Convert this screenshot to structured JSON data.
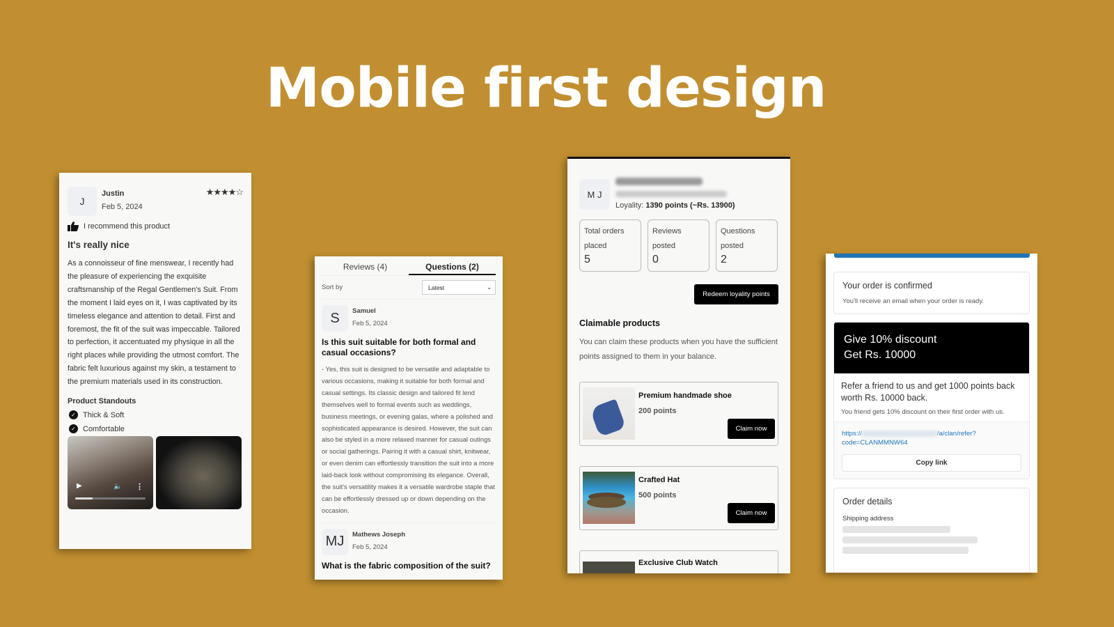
{
  "hero": {
    "title": "Mobile first design"
  },
  "review_panel": {
    "avatar_initial": "J",
    "name": "Justin",
    "date": "Feb 5, 2024",
    "rating": 4,
    "rating_max": 5,
    "stars_text": "★★★★☆",
    "recommend_text": "I recommend this product",
    "title": "It's really nice",
    "body": "As a connoisseur of fine menswear, I recently had the pleasure of experiencing the exquisite craftsmanship of the Regal Gentlemen's Suit. From the moment I laid eyes on it, I was captivated by its timeless elegance and attention to detail. First and foremost, the fit of the suit was impeccable. Tailored to perfection, it accentuated my physique in all the right places while providing the utmost comfort. The fabric felt luxurious against my skin, a testament to the premium materials used in its construction.",
    "standouts_title": "Product Standouts",
    "standouts": [
      "Thick & Soft",
      "Comfortable"
    ],
    "video_progress": 0.25
  },
  "questions_panel": {
    "tabs": [
      {
        "label": "Reviews (4)",
        "active": false
      },
      {
        "label": "Questions (2)",
        "active": true
      }
    ],
    "sort_label": "Sort by",
    "sort_value": "Latest",
    "questions": [
      {
        "avatar": "S",
        "name": "Samuel",
        "date": "Feb 5, 2024",
        "question": "Is this suit suitable for both formal and casual occasions?",
        "answer": "- Yes, this suit is designed to be versatile and adaptable to various occasions, making it suitable for both formal and casual settings. Its classic design and tailored fit lend themselves well to formal events such as weddings, business meetings, or evening galas, where a polished and sophisticated appearance is desired. However, the suit can also be styled in a more relaxed manner for casual outings or social gatherings. Pairing it with a casual shirt, knitwear, or even denim can effortlessly transition the suit into a more laid-back look without compromising its elegance. Overall, the suit's versatility makes it a versatile wardrobe staple that can be effortlessly dressed up or down depending on the occasion."
      },
      {
        "avatar": "MJ",
        "name": "Mathews Joseph",
        "date": "Feb 5, 2024",
        "question": "What is the fabric composition of the suit?",
        "answer": ""
      }
    ]
  },
  "loyalty_panel": {
    "avatar": "M J",
    "loyalty_label": "Loyality:",
    "loyalty_value": "1390 points (~Rs. 13900)",
    "stats": [
      {
        "label": "Total orders placed",
        "value": "5"
      },
      {
        "label": "Reviews posted",
        "value": "0"
      },
      {
        "label": "Questions posted",
        "value": "2"
      }
    ],
    "redeem_label": "Redeem loyality points",
    "claimable_title": "Claimable products",
    "claimable_desc": "You can claim these products when you have the sufficient points assigned to them in your balance.",
    "products": [
      {
        "name": "Premium handmade shoe",
        "points": "200 points",
        "cta": "Claim now"
      },
      {
        "name": "Crafted Hat",
        "points": "500 points",
        "cta": "Claim now"
      },
      {
        "name": "Exclusive Club Watch",
        "points": "",
        "cta": ""
      }
    ]
  },
  "order_panel": {
    "confirm_title": "Your order is confirmed",
    "confirm_sub": "You'll receive an email when your order is ready.",
    "promo_line1": "Give 10% discount",
    "promo_line2": "Get Rs. 10000",
    "refer_text": "Refer a friend to us and get 1000 points back worth Rs. 10000 back.",
    "refer_small": "You friend gets 10% discount on their first order with us.",
    "link_prefix": "https://",
    "link_suffix": "/a/clan/refer?",
    "link_code": "code=CLANMMNW64",
    "copy_label": "Copy link",
    "order_details_title": "Order details",
    "shipping_label": "Shipping address"
  }
}
